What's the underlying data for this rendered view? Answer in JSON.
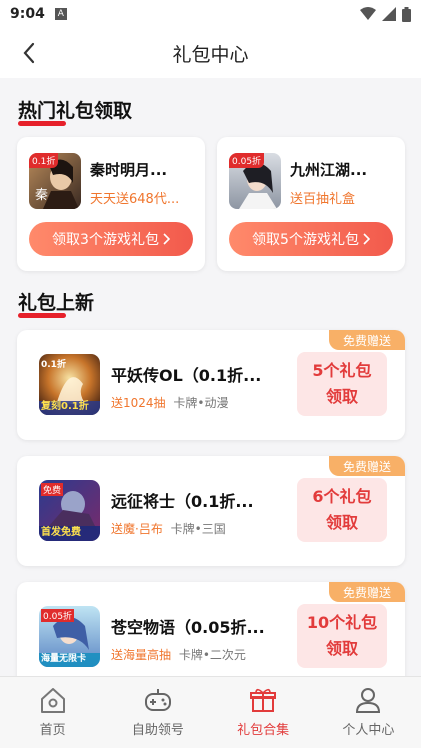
{
  "status": {
    "time": "9:04",
    "indicator": "A"
  },
  "header": {
    "title": "礼包中心"
  },
  "hot": {
    "title": "热门礼包领取",
    "items": [
      {
        "name": "秦时明月...",
        "desc": "天天送648代...",
        "button": "领取3个游戏礼包",
        "badge": "0.1折"
      },
      {
        "name": "九州江湖...",
        "desc": "送百抽礼盒",
        "button": "领取5个游戏礼包",
        "badge": "0.05折"
      }
    ]
  },
  "new": {
    "title": "礼包上新",
    "items": [
      {
        "tag": "免费赠送",
        "name": "平妖传OL（0.1折...",
        "highlight": "送1024抽",
        "tags": "卡牌•动漫",
        "claim_count": "5个礼包",
        "claim_action": "领取",
        "badge": "0.1折",
        "banner": "复刻0.1折"
      },
      {
        "tag": "免费赠送",
        "name": "远征将士（0.1折...",
        "highlight": "送魔·吕布",
        "tags": "卡牌•三国",
        "claim_count": "6个礼包",
        "claim_action": "领取",
        "badge": "免费",
        "banner": "首发免费"
      },
      {
        "tag": "免费赠送",
        "name": "苍空物语（0.05折...",
        "highlight": "送海量高抽",
        "tags": "卡牌•二次元",
        "claim_count": "10个礼包",
        "claim_action": "领取",
        "badge": "0.05折",
        "banner": "海量无限卡"
      }
    ]
  },
  "tabs": [
    {
      "label": "首页",
      "icon": "home-icon"
    },
    {
      "label": "自助领号",
      "icon": "gamepad-icon"
    },
    {
      "label": "礼包合集",
      "icon": "gift-icon"
    },
    {
      "label": "个人中心",
      "icon": "user-icon"
    }
  ],
  "colors": {
    "accent": "#e23b3b",
    "orange": "#f0762e",
    "tag": "#f8b067"
  }
}
